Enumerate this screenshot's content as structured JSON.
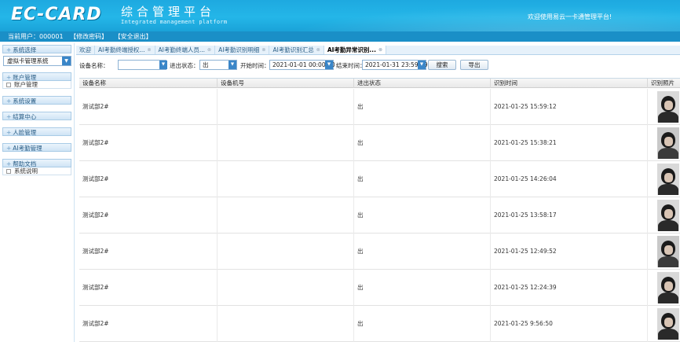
{
  "header": {
    "logo": "EC-CARD",
    "title": "综合管理平台",
    "subtitle": "Integrated management platform",
    "welcome": "欢迎使用易云一卡通管理平台!"
  },
  "userbar": {
    "current_user": "当前用户：000001",
    "change_password": "【修改密码】",
    "logout": "【安全退出】"
  },
  "sidebar": {
    "system_select_head": "系统选择",
    "system_select_value": "虚拟卡管理系统",
    "sections": [
      {
        "label": "账户管理",
        "items": [
          "账户管理"
        ]
      },
      {
        "label": "系统设置",
        "items": []
      },
      {
        "label": "结算中心",
        "items": []
      },
      {
        "label": "人脸管理",
        "items": []
      },
      {
        "label": "AI考勤管理",
        "items": []
      },
      {
        "label": "帮助文档",
        "items": [
          "系统说明"
        ]
      }
    ]
  },
  "tabs": [
    {
      "label": "欢迎",
      "closable": false,
      "active": false
    },
    {
      "label": "AI考勤终端授权...",
      "closable": true,
      "active": false
    },
    {
      "label": "AI考勤终端人员...",
      "closable": true,
      "active": false
    },
    {
      "label": "AI考勤识别明细",
      "closable": true,
      "active": false
    },
    {
      "label": "AI考勤识别汇总",
      "closable": true,
      "active": false
    },
    {
      "label": "AI考勤异常识别...",
      "closable": true,
      "active": true
    }
  ],
  "filters": {
    "device_name_label": "设备名称：",
    "device_name_value": "",
    "inout_label": "进出状态：",
    "inout_value": "出",
    "start_label": "开始时间：",
    "start_value": "2021-01-01 00:00:00",
    "end_label": "结束时间：",
    "end_value": "2021-01-31 23:59:59",
    "search_button": "搜索",
    "export_button": "导出"
  },
  "table": {
    "columns": [
      "设备名称",
      "设备机号",
      "进出状态",
      "识别时间",
      "识别照片"
    ],
    "rows": [
      {
        "device": "测试部2#",
        "machine_no": "",
        "status": "出",
        "time": "2021-01-25 15:59:12"
      },
      {
        "device": "测试部2#",
        "machine_no": "",
        "status": "出",
        "time": "2021-01-25 15:38:21"
      },
      {
        "device": "测试部2#",
        "machine_no": "",
        "status": "出",
        "time": "2021-01-25 14:26:04"
      },
      {
        "device": "测试部2#",
        "machine_no": "",
        "status": "出",
        "time": "2021-01-25 13:58:17"
      },
      {
        "device": "测试部2#",
        "machine_no": "",
        "status": "出",
        "time": "2021-01-25 12:49:52"
      },
      {
        "device": "测试部2#",
        "machine_no": "",
        "status": "出",
        "time": "2021-01-25 12:24:39"
      },
      {
        "device": "测试部2#",
        "machine_no": "",
        "status": "出",
        "time": "2021-01-25 9:56:50"
      }
    ]
  }
}
